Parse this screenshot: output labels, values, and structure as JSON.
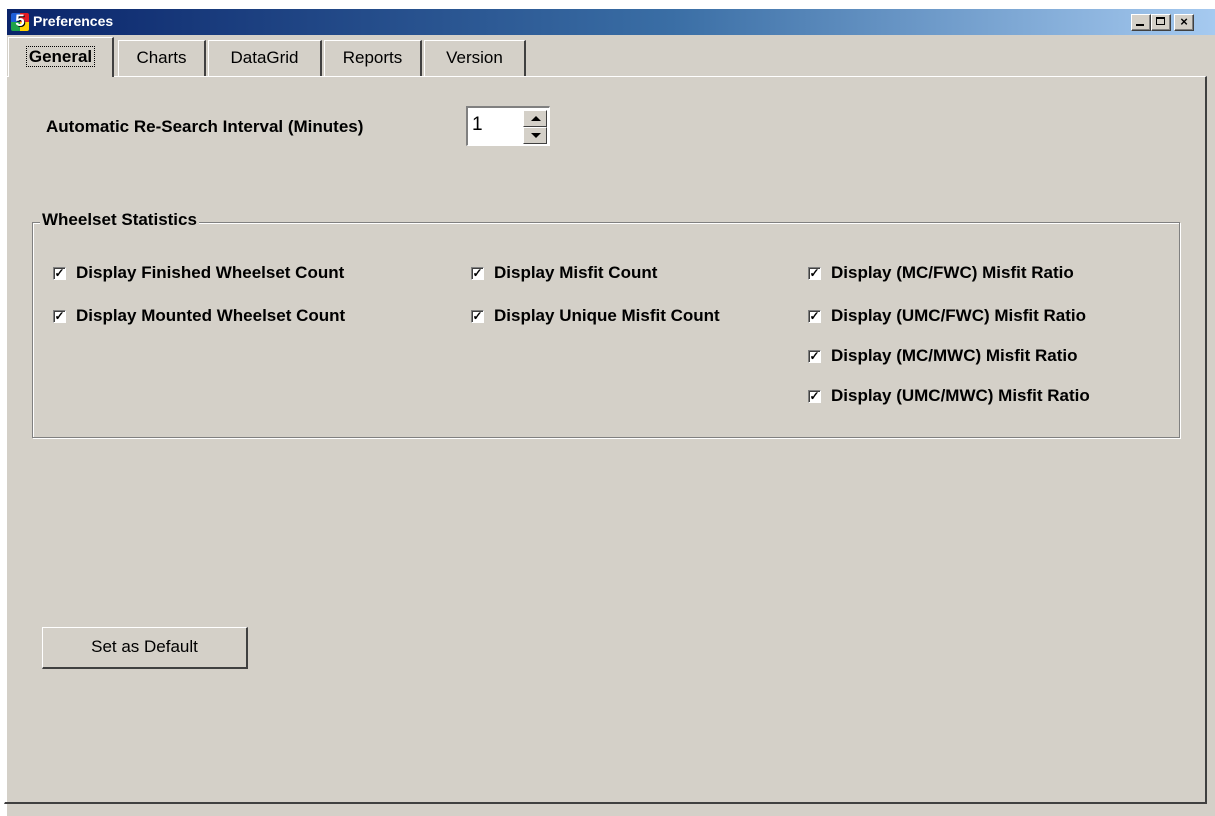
{
  "window": {
    "title": "Preferences",
    "icon_glyph": "5",
    "controls": {
      "minimize": "minimize-icon",
      "maximize": "maximize-icon",
      "close": "close-icon",
      "close_glyph": "×"
    }
  },
  "tabs": [
    {
      "label": "General",
      "active": true
    },
    {
      "label": "Charts",
      "active": false
    },
    {
      "label": "DataGrid",
      "active": false
    },
    {
      "label": "Reports",
      "active": false
    },
    {
      "label": "Version",
      "active": false
    }
  ],
  "general": {
    "research_interval_label": "Automatic Re-Search Interval (Minutes)",
    "research_interval_value": "1",
    "wheelset_group_title": "Wheelset Statistics",
    "checkboxes": [
      {
        "label": "Display Finished Wheelset Count",
        "checked": true
      },
      {
        "label": "Display Mounted Wheelset Count",
        "checked": true
      },
      {
        "label": "Display Misfit Count",
        "checked": true
      },
      {
        "label": "Display Unique Misfit Count",
        "checked": true
      },
      {
        "label": "Display (MC/FWC) Misfit Ratio",
        "checked": true
      },
      {
        "label": "Display (UMC/FWC) Misfit Ratio",
        "checked": true
      },
      {
        "label": "Display (MC/MWC) Misfit Ratio",
        "checked": true
      },
      {
        "label": "Display (UMC/MWC) Misfit Ratio",
        "checked": true
      }
    ],
    "check_glyph": "✓",
    "set_default_label": "Set as Default"
  },
  "colors": {
    "window_bg": "#d4d0c8",
    "titlebar_start": "#0a246a",
    "titlebar_end": "#a6caf0"
  }
}
